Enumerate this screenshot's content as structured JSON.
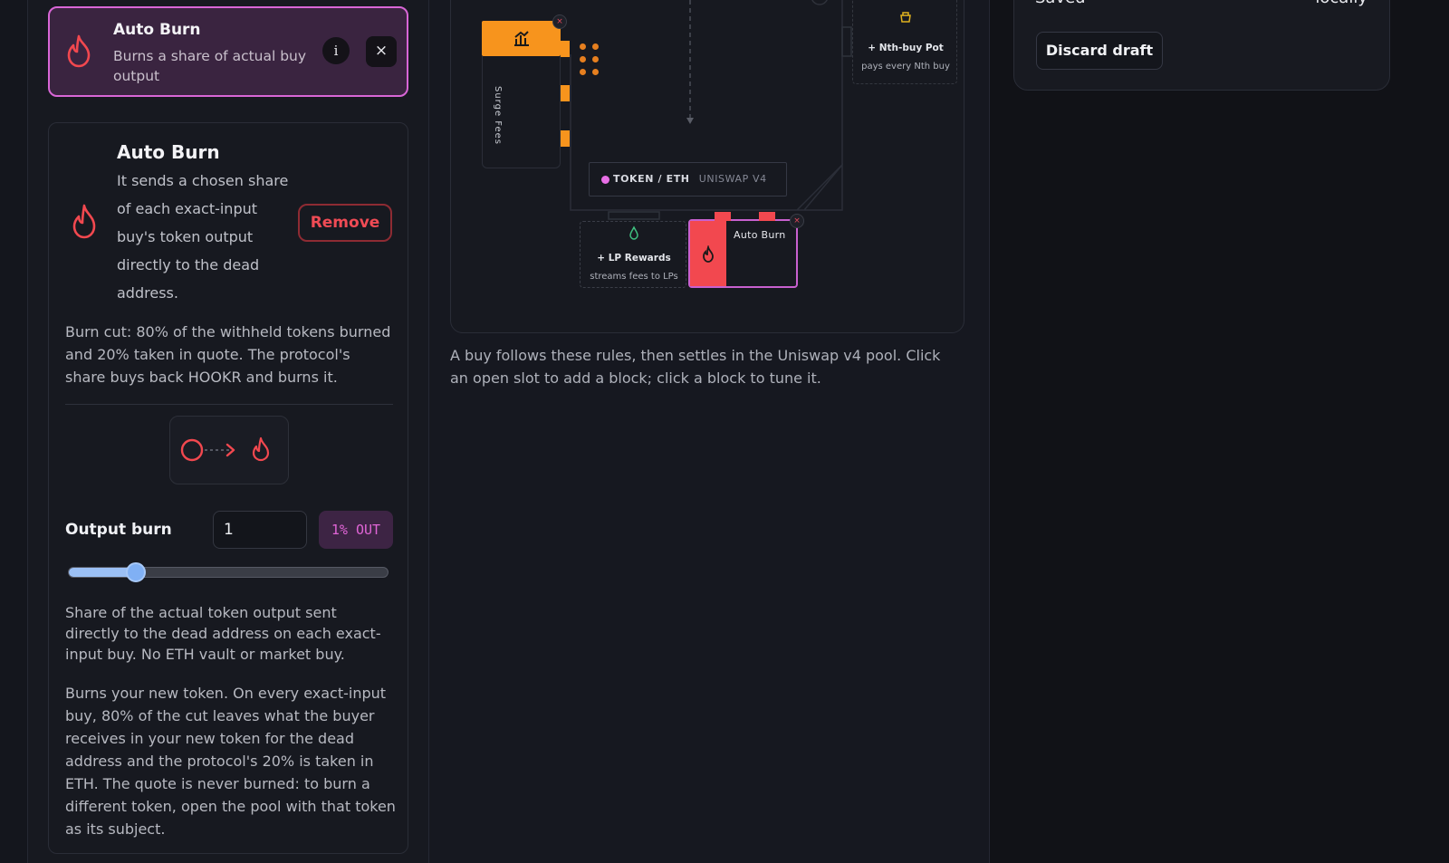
{
  "selected_block": {
    "title": "Auto Burn",
    "description": "Burns a share of actual buy output",
    "info_label": "i",
    "close_label": "×",
    "icon": "flame-icon"
  },
  "detail": {
    "title": "Auto Burn",
    "description": "It sends a chosen share of each exact-input buy's token output directly to the dead address.",
    "remove_label": "Remove",
    "burn_cut": "Burn cut: 80% of the withheld tokens burned and 20% taken in quote. The protocol's share buys back HOOKR and burns it.",
    "output_burn_label": "Output burn",
    "output_burn_value": "1",
    "output_burn_pill": "1% OUT",
    "slider_fraction": 0.2,
    "share_text": "Share of the actual token output sent directly to the dead address on each exact-input buy. No ETH vault or market buy.",
    "burns_text": "Burns your new token. On every exact-input buy, 80% of the cut leaves what the buyer receives in your new token for the dead address and the protocol's 20% is taken in ETH. The quote is never burned: to burn a different token, open the pool with that token as its subject."
  },
  "canvas": {
    "surge_label": "Surge Fees",
    "token_pair": "TOKEN / ETH",
    "pool_name": "UNISWAP V4",
    "lp_slot_label": "+ LP Rewards",
    "lp_slot_sub": "streams fees to LPs",
    "auto_burn_label": "Auto Burn",
    "nth_slot_label": "+ Nth-buy Pot",
    "nth_slot_sub": "pays every Nth buy",
    "caption": "A buy follows these rules, then settles in the Uniswap v4 pool. Click an open slot to add a block; click a block to tune it."
  },
  "right_panel": {
    "saved_text": "Saved",
    "locally_text": "locally",
    "discard_label": "Discard draft"
  },
  "colors": {
    "accent_pink": "#d866d6",
    "flame_red": "#f2484f",
    "surge_orange": "#f7941d",
    "slider_blue": "#80b0f4"
  }
}
